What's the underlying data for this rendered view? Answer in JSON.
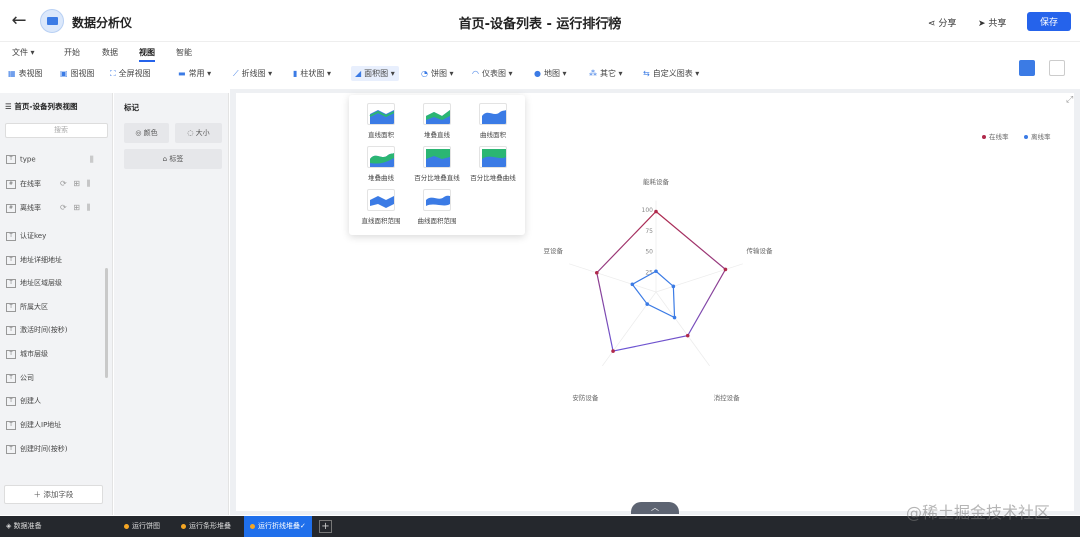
{
  "header": {
    "app_name": "数据分析仪",
    "title": "首页-设备列表 - 运行排行榜",
    "share_label": "分享",
    "cowork_label": "共享",
    "save_label": "保存"
  },
  "menu": [
    {
      "label": "文件 ▾",
      "active": false
    },
    {
      "label": "开始",
      "active": false
    },
    {
      "label": "数据",
      "active": false
    },
    {
      "label": "视图",
      "active": true
    },
    {
      "label": "智能",
      "active": false
    }
  ],
  "toolbar": [
    {
      "label": "表视图",
      "icon": "table-icon"
    },
    {
      "label": "图视图",
      "icon": "chart-view-icon"
    },
    {
      "label": "全屏视图",
      "icon": "fullscreen-icon"
    },
    {
      "label": "常用 ▾",
      "icon": "common-chart-icon"
    },
    {
      "label": "折线图 ▾",
      "icon": "line-chart-icon"
    },
    {
      "label": "柱状图 ▾",
      "icon": "bar-chart-icon"
    },
    {
      "label": "面积图 ▾",
      "icon": "area-chart-icon",
      "selected": true
    },
    {
      "label": "饼图 ▾",
      "icon": "pie-chart-icon"
    },
    {
      "label": "仪表图 ▾",
      "icon": "gauge-icon"
    },
    {
      "label": "地图 ▾",
      "icon": "map-pin-icon"
    },
    {
      "label": "其它 ▾",
      "icon": "other-icon"
    },
    {
      "label": "自定义图表 ▾",
      "icon": "custom-chart-icon"
    }
  ],
  "fields_panel": {
    "title": "首页-设备列表视图",
    "search_placeholder": "搜索",
    "items": [
      {
        "label": "type",
        "tag": "T",
        "actions": "⫼"
      },
      {
        "label": "在线率",
        "tag": "#",
        "actions": "⟳ ⊞ ⫼"
      },
      {
        "label": "离线率",
        "tag": "#",
        "actions": "⟳ ⊞ ⫼"
      },
      {
        "label": "认证key",
        "tag": "T",
        "actions": ""
      },
      {
        "label": "地址详细地址",
        "tag": "T",
        "actions": ""
      },
      {
        "label": "地址区域层级",
        "tag": "T",
        "actions": ""
      },
      {
        "label": "所属大区",
        "tag": "T",
        "actions": ""
      },
      {
        "label": "激活时间(按秒)",
        "tag": "T",
        "actions": ""
      },
      {
        "label": "城市层级",
        "tag": "T",
        "actions": ""
      },
      {
        "label": "公司",
        "tag": "T",
        "actions": ""
      },
      {
        "label": "创建人",
        "tag": "T",
        "actions": ""
      },
      {
        "label": "创建人IP地址",
        "tag": "T",
        "actions": ""
      },
      {
        "label": "创建时间(按秒)",
        "tag": "T",
        "actions": ""
      }
    ],
    "add_field_label": "＋ 添加字段"
  },
  "marks_panel": {
    "title": "标记",
    "color_label": "颜色",
    "size_label": "大小",
    "label_label": "标签"
  },
  "area_dropdown": [
    "直线面积",
    "堆叠直线",
    "曲线面积",
    "堆叠曲线",
    "百分比堆叠直线",
    "百分比堆叠曲线",
    "直线面积范围",
    "曲线面积范围"
  ],
  "bottom_tabs": [
    {
      "label": "数据准备",
      "active": false
    },
    {
      "label": "运行饼图",
      "active": false
    },
    {
      "label": "运行条形堆叠",
      "active": false
    },
    {
      "label": "运行折线堆叠✓",
      "active": true
    }
  ],
  "watermark": "@稀土掘金技术社区",
  "colors": {
    "accent": "#2563eb",
    "online_series": "#b0294b",
    "offline_series": "#3b7be5"
  },
  "chart_data": {
    "type": "radar",
    "indicators": [
      "能耗设备",
      "传输设备",
      "消控设备",
      "安防设备",
      "豆设备"
    ],
    "radial_ticks": [
      25,
      50,
      75,
      100
    ],
    "rmax": 100,
    "legend_position": "top-right",
    "series": [
      {
        "name": "在线率",
        "values": [
          97,
          88,
          65,
          88,
          75
        ]
      },
      {
        "name": "离线率",
        "values": [
          25,
          22,
          38,
          18,
          30
        ]
      }
    ]
  }
}
